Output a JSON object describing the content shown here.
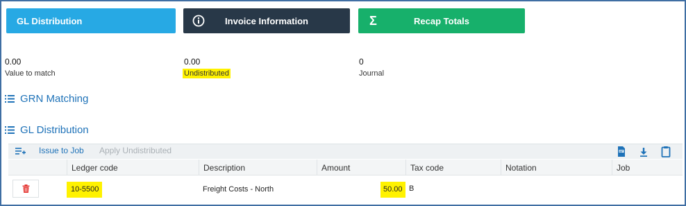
{
  "tabs": {
    "gl_distribution": "GL Distribution",
    "invoice_information": "Invoice Information",
    "recap_totals": "Recap Totals"
  },
  "stats": [
    {
      "value": "0.00",
      "label": "Value to match"
    },
    {
      "value": "0.00",
      "label": "Undistributed",
      "highlighted": true
    },
    {
      "value": "0",
      "label": "Journal"
    }
  ],
  "sections": {
    "grn_matching": "GRN Matching",
    "gl_distribution": "GL Distribution"
  },
  "toolbar": {
    "issue_to_job": "Issue to Job",
    "apply_undistributed": "Apply Undistributed",
    "icons": [
      "add-list-icon",
      "pdf-icon",
      "download-icon",
      "clipboard-icon"
    ]
  },
  "table": {
    "columns": [
      "Ledger code",
      "Description",
      "Amount",
      "Tax code",
      "Notation",
      "Job"
    ],
    "rows": [
      {
        "ledger_code": "10-5500",
        "description": "Freight Costs - North",
        "amount": "50.00",
        "tax_code": "B",
        "notation": "",
        "job": ""
      }
    ]
  },
  "colors": {
    "gl_tab": "#27a9e4",
    "invoice_tab": "#283848",
    "recap_tab": "#17b06b",
    "link": "#1e72b8",
    "highlight": "#fff200",
    "delete": "#e53935"
  }
}
